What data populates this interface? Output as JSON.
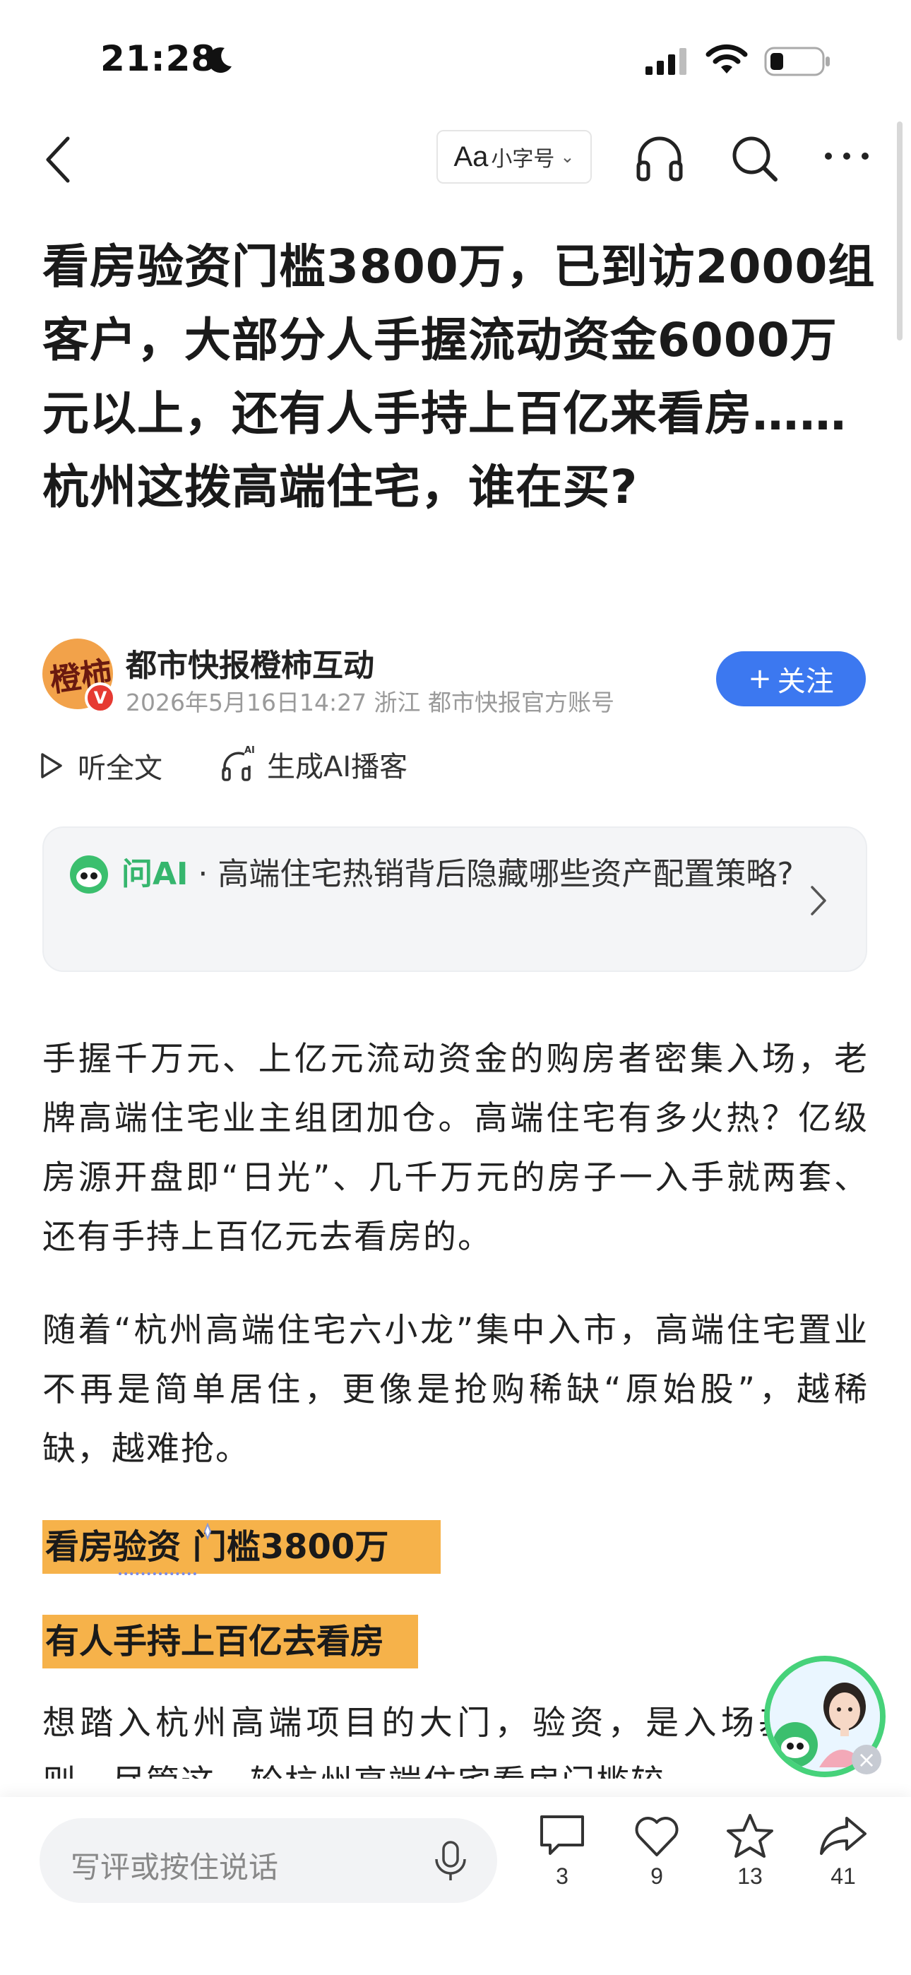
{
  "status_bar": {
    "time": "21:28"
  },
  "nav": {
    "font_size_label": "小字号",
    "font_size_aa": "Aa"
  },
  "article": {
    "title": "看房验资门槛3800万，已到访2000组客户，大部分人手握流动资金6000万元以上，还有人手持上百亿来看房……杭州这拨高端住宅，谁在买?"
  },
  "author": {
    "name": "都市快报橙柿互动",
    "meta": "2026年5月16日14:27 浙江 都市快报官方账号",
    "avatar_text": "橙柿",
    "verified_mark": "V",
    "follow_label": "关注",
    "follow_plus": "+"
  },
  "actions": {
    "listen_label": "听全文",
    "ai_podcast_label": "生成AI播客"
  },
  "ask_ai": {
    "brand": "问AI",
    "separator": " · ",
    "question": "高端住宅热销背后隐藏哪些资产配置策略?"
  },
  "body": {
    "p1": "手握千万元、上亿元流动资金的购房者密集入场，老牌高端住宅业主组团加仓。高端住宅有多火热？亿级房源开盘即“日光”、几千万元的房子一入手就两套、 还有手持上百亿元去看房的。",
    "p2": "随着“杭州高端住宅六小龙”集中入市，高端住宅置业不再是简单居住，更像是抢购稀缺“原始股”，越稀缺，越难抢。",
    "sub1_a": "看房验资",
    "sub1_b": " 门槛3800万",
    "sub2": "有人手持上百亿去看房",
    "p3": "想踏入杭州高端项目的大门，验资，是入场基本规则。尽管这一轮杭州高端住宅看房门槛较"
  },
  "bottom_bar": {
    "comment_placeholder": "写评或按住说话",
    "comment_count": "3",
    "like_count": "9",
    "favorite_count": "13",
    "share_count": "41"
  },
  "colors": {
    "accent_blue": "#3c78f0",
    "ai_green": "#36b66e",
    "highlight_orange": "#f6b24a"
  }
}
